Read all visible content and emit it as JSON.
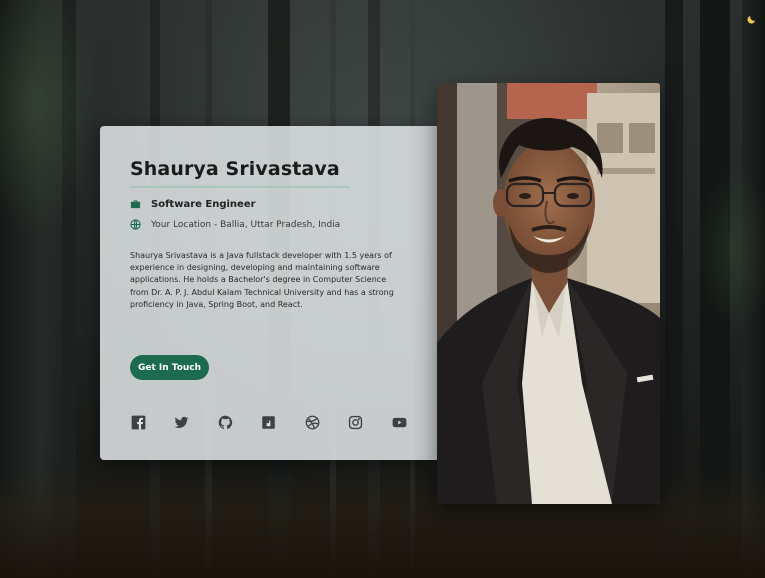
{
  "profile": {
    "name": "Shaurya Srivastava",
    "title": "Software Engineer",
    "location": "Your Location - Ballia, Uttar Pradesh, India",
    "bio": "Shaurya Srivastava is a Java fullstack developer with 1.5 years of experience in designing, developing and maintaining software applications. He holds a Bachelor's degree in Computer Science from Dr. A. P. J. Abdul Kalam Technical University and has a strong proficiency in Java, Spring Boot, and React.",
    "cta_label": "Get In Touch"
  },
  "socials": [
    {
      "icon": "facebook-icon"
    },
    {
      "icon": "twitter-icon"
    },
    {
      "icon": "github-icon"
    },
    {
      "icon": "hashnode-icon"
    },
    {
      "icon": "dribbble-icon"
    },
    {
      "icon": "instagram-icon"
    },
    {
      "icon": "youtube-icon"
    }
  ],
  "theme": {
    "accent": "#1d6b4e",
    "card_bg": "#dee2e5",
    "toggle_icon": "moon-icon"
  }
}
